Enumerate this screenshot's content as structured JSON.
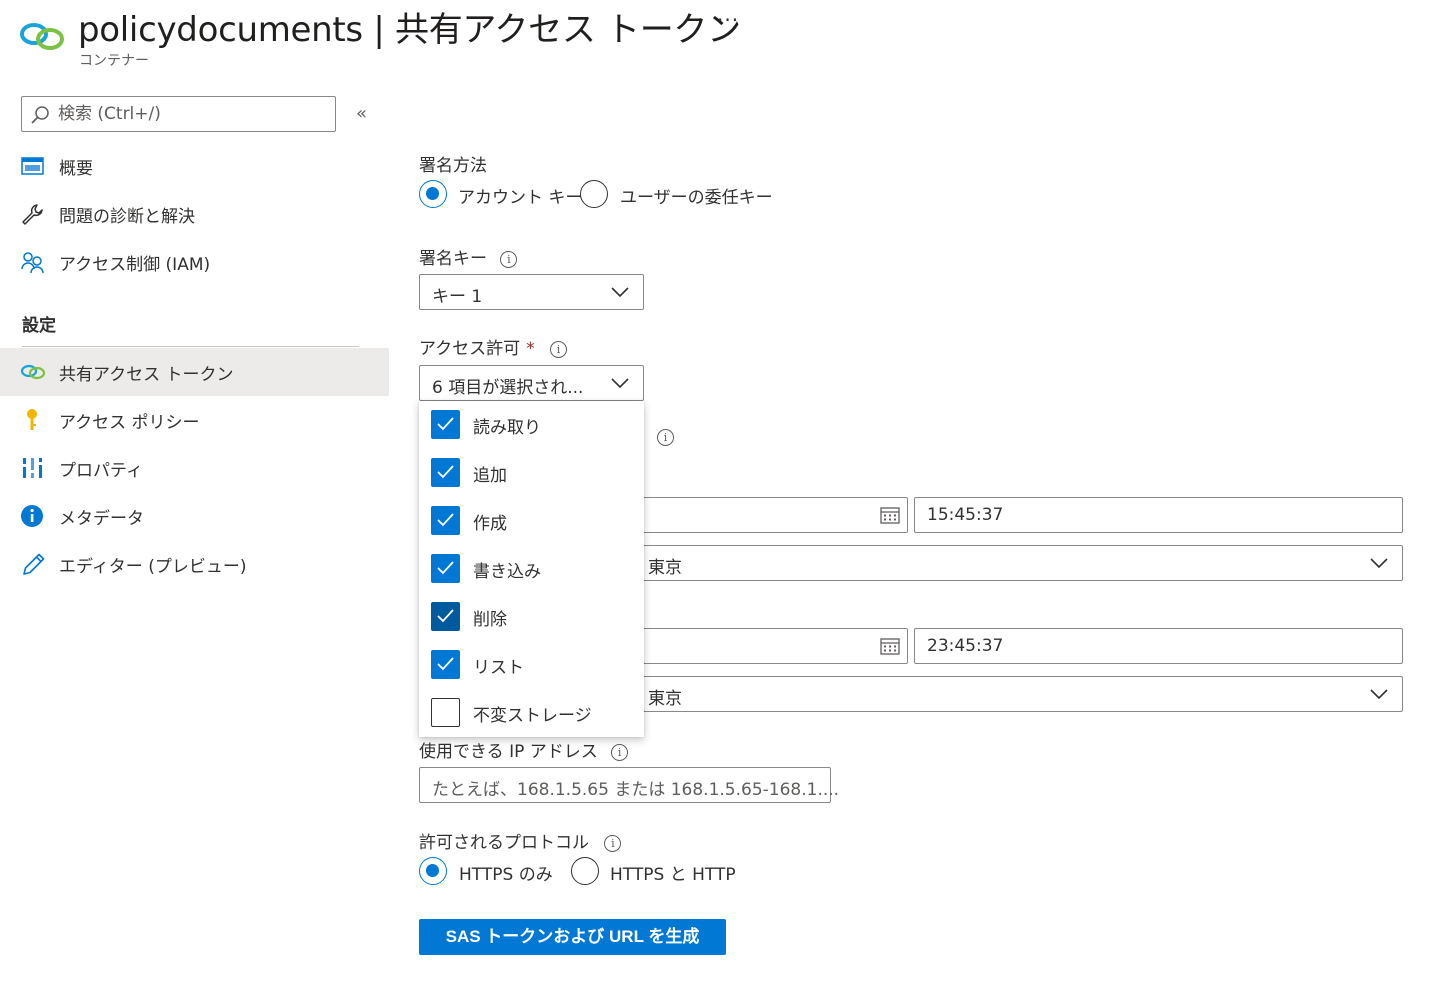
{
  "header": {
    "title": "policydocuments | 共有アクセス トークン",
    "more": "···",
    "subtitle": "コンテナー"
  },
  "sidebar": {
    "search_placeholder": "検索 (Ctrl+/)",
    "collapse": "«",
    "items": [
      {
        "label": "概要",
        "icon": "overview-icon"
      },
      {
        "label": "問題の診断と解決",
        "icon": "wrench-icon"
      },
      {
        "label": "アクセス制御 (IAM)",
        "icon": "people-icon"
      }
    ],
    "section_title": "設定",
    "settings_items": [
      {
        "label": "共有アクセス トークン",
        "icon": "link-icon",
        "active": true
      },
      {
        "label": "アクセス ポリシー",
        "icon": "key-icon"
      },
      {
        "label": "プロパティ",
        "icon": "properties-icon"
      },
      {
        "label": "メタデータ",
        "icon": "info-icon"
      },
      {
        "label": "エディター (プレビュー)",
        "icon": "pencil-icon"
      }
    ]
  },
  "form": {
    "signing_method": {
      "label": "署名方法",
      "options": [
        {
          "label": "アカウント キー",
          "selected": true
        },
        {
          "label": "ユーザーの委任キー",
          "selected": false
        }
      ]
    },
    "signing_key": {
      "label": "署名キー",
      "value": "キー 1"
    },
    "permissions": {
      "label": "アクセス許可",
      "required_mark": "*",
      "value": "6 項目が選択され...",
      "options": [
        {
          "label": "読み取り",
          "checked": true
        },
        {
          "label": "追加",
          "checked": true
        },
        {
          "label": "作成",
          "checked": true
        },
        {
          "label": "書き込み",
          "checked": true
        },
        {
          "label": "削除",
          "checked": true,
          "focused": true
        },
        {
          "label": "リスト",
          "checked": true
        },
        {
          "label": "不変ストレージ",
          "checked": false
        }
      ]
    },
    "start": {
      "time": "15:45:37",
      "timezone": "東京"
    },
    "expiry": {
      "time": "23:45:37",
      "timezone": "東京"
    },
    "allowed_ip": {
      "label": "使用できる IP アドレス",
      "placeholder": "たとえば、168.1.5.65 または 168.1.5.65-168.1...."
    },
    "protocols": {
      "label": "許可されるプロトコル",
      "options": [
        {
          "label": "HTTPS のみ",
          "selected": true
        },
        {
          "label": "HTTPS と HTTP",
          "selected": false
        }
      ]
    },
    "generate_button": "SAS トークンおよび URL を生成"
  },
  "colors": {
    "accent": "#0078d4",
    "accent_dark": "#005a9e",
    "required": "#a4262c",
    "active_nav_bg": "#edebe9"
  }
}
